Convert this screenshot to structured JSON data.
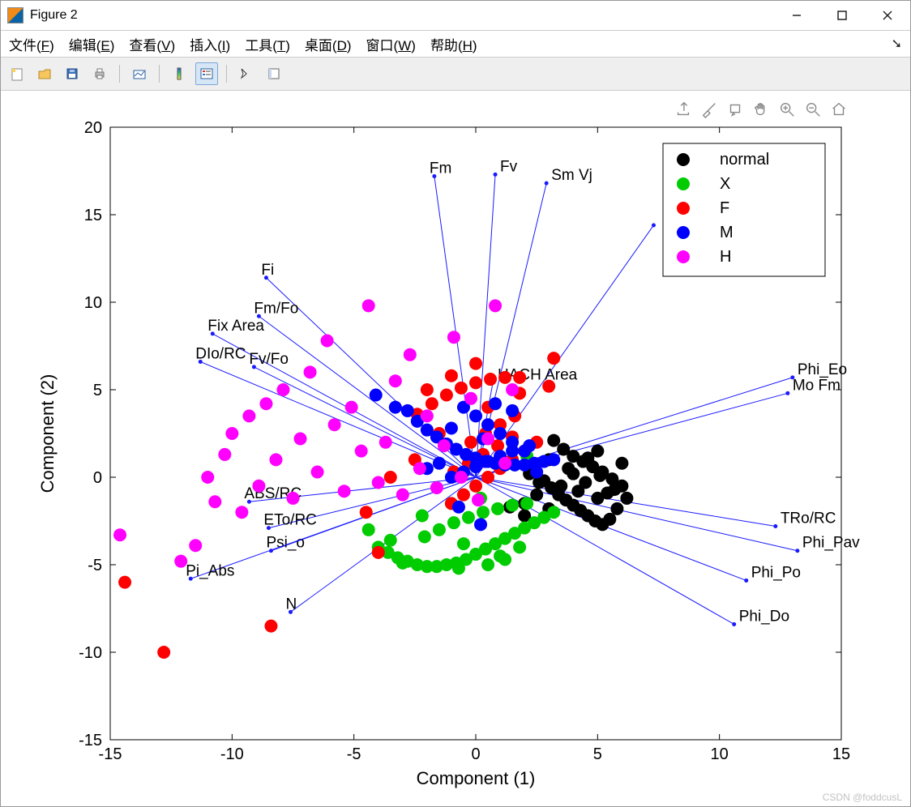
{
  "window": {
    "title": "Figure 2"
  },
  "menu": {
    "file": {
      "label": "文件",
      "mn": "F"
    },
    "edit": {
      "label": "编辑",
      "mn": "E"
    },
    "view": {
      "label": "查看",
      "mn": "V"
    },
    "insert": {
      "label": "插入",
      "mn": "I"
    },
    "tools": {
      "label": "工具",
      "mn": "T"
    },
    "desktop": {
      "label": "桌面",
      "mn": "D"
    },
    "window": {
      "label": "窗口",
      "mn": "W"
    },
    "help": {
      "label": "帮助",
      "mn": "H"
    }
  },
  "axes_toolbar": {
    "export": "export-icon",
    "brush": "brush-icon",
    "datatip": "data-tip-icon",
    "pan": "pan-icon",
    "zoomin": "zoom-in-icon",
    "zoomout": "zoom-out-icon",
    "home": "home-icon"
  },
  "legend": {
    "entries": [
      {
        "label": "normal",
        "color": "#000000"
      },
      {
        "label": "X",
        "color": "#00cc00"
      },
      {
        "label": "F",
        "color": "#ff0000"
      },
      {
        "label": "M",
        "color": "#0000ff"
      },
      {
        "label": "H",
        "color": "#ff00ff"
      }
    ]
  },
  "chart_data": {
    "type": "scatter",
    "title": "",
    "xlabel": "Component (1)",
    "ylabel": "Component (2)",
    "xlim": [
      -15,
      15
    ],
    "ylim": [
      -15,
      20
    ],
    "xticks": [
      -15,
      -10,
      -5,
      0,
      5,
      10,
      15
    ],
    "yticks": [
      -15,
      -10,
      -5,
      0,
      5,
      10,
      15,
      20
    ],
    "grid": false,
    "legend_position": "top-right",
    "biplot_vectors": [
      {
        "name": "Fm",
        "x": -1.7,
        "y": 17.2
      },
      {
        "name": "Fv",
        "x": 0.8,
        "y": 17.3
      },
      {
        "name": "Sm Vj",
        "x": 2.9,
        "y": 16.8
      },
      {
        "name": "",
        "x": 7.3,
        "y": 14.4
      },
      {
        "name": "Fi",
        "x": -8.6,
        "y": 11.4
      },
      {
        "name": "Fm/Fo",
        "x": -8.9,
        "y": 9.2
      },
      {
        "name": "Fix Area",
        "x": -10.8,
        "y": 8.2
      },
      {
        "name": "DIo/RC",
        "x": -11.3,
        "y": 6.6
      },
      {
        "name": "Fv/Fo",
        "x": -9.1,
        "y": 6.3
      },
      {
        "name": "HACH Area",
        "x": 0.7,
        "y": 5.4
      },
      {
        "name": "Phi_Eo",
        "x": 13.0,
        "y": 5.7
      },
      {
        "name": "Mo Fm",
        "x": 12.8,
        "y": 4.8
      },
      {
        "name": "ABS/RC",
        "x": -9.3,
        "y": -1.4
      },
      {
        "name": "ETo/RC",
        "x": -8.5,
        "y": -2.9
      },
      {
        "name": "Psi_o",
        "x": -8.4,
        "y": -4.2
      },
      {
        "name": "Pi_Abs",
        "x": -11.7,
        "y": -5.8
      },
      {
        "name": "N",
        "x": -7.6,
        "y": -7.7
      },
      {
        "name": "TRo/RC",
        "x": 12.3,
        "y": -2.8
      },
      {
        "name": "Phi_Pav",
        "x": 13.2,
        "y": -4.2
      },
      {
        "name": "Phi_Po",
        "x": 11.1,
        "y": -5.9
      },
      {
        "name": "Phi_Do",
        "x": 10.6,
        "y": -8.4
      }
    ],
    "series": [
      {
        "name": "normal",
        "color": "#000000",
        "points": [
          [
            3.2,
            2.1
          ],
          [
            3.6,
            1.6
          ],
          [
            4.0,
            1.2
          ],
          [
            4.4,
            0.9
          ],
          [
            4.8,
            0.6
          ],
          [
            5.2,
            0.3
          ],
          [
            5.6,
            -0.1
          ],
          [
            6.0,
            -0.5
          ],
          [
            2.8,
            -0.2
          ],
          [
            3.1,
            -0.6
          ],
          [
            3.4,
            -1.0
          ],
          [
            3.7,
            -1.3
          ],
          [
            4.0,
            -1.6
          ],
          [
            4.3,
            -1.9
          ],
          [
            4.6,
            -2.2
          ],
          [
            4.9,
            -2.5
          ],
          [
            5.2,
            -2.7
          ],
          [
            5.5,
            -2.4
          ],
          [
            5.8,
            -1.8
          ],
          [
            6.2,
            -1.2
          ],
          [
            6.0,
            0.8
          ],
          [
            5.0,
            1.5
          ],
          [
            4.5,
            -0.3
          ],
          [
            3.0,
            1.0
          ],
          [
            2.0,
            -1.5
          ],
          [
            2.5,
            -1.0
          ],
          [
            3.0,
            -1.8
          ],
          [
            3.5,
            -0.5
          ],
          [
            4.0,
            0.2
          ],
          [
            4.2,
            -0.8
          ],
          [
            5.0,
            -1.2
          ],
          [
            5.4,
            -0.9
          ],
          [
            2.2,
            0.2
          ],
          [
            2.6,
            -0.3
          ],
          [
            3.8,
            0.5
          ],
          [
            4.6,
            1.1
          ],
          [
            5.1,
            0.1
          ],
          [
            5.7,
            -0.7
          ],
          [
            1.4,
            -1.7
          ],
          [
            2.0,
            -2.2
          ]
        ]
      },
      {
        "name": "X",
        "color": "#00cc00",
        "points": [
          [
            -4.4,
            -3.0
          ],
          [
            -4.0,
            -4.0
          ],
          [
            -3.6,
            -4.3
          ],
          [
            -3.2,
            -4.6
          ],
          [
            -2.8,
            -4.8
          ],
          [
            -2.4,
            -5.0
          ],
          [
            -2.0,
            -5.1
          ],
          [
            -1.6,
            -5.1
          ],
          [
            -1.2,
            -5.0
          ],
          [
            -0.8,
            -4.9
          ],
          [
            -0.4,
            -4.7
          ],
          [
            0.0,
            -4.4
          ],
          [
            0.4,
            -4.1
          ],
          [
            0.8,
            -3.8
          ],
          [
            1.2,
            -3.5
          ],
          [
            1.6,
            -3.2
          ],
          [
            2.0,
            -2.9
          ],
          [
            2.4,
            -2.6
          ],
          [
            2.8,
            -2.3
          ],
          [
            3.2,
            -2.0
          ],
          [
            -2.1,
            -3.4
          ],
          [
            -1.5,
            -3.0
          ],
          [
            -0.9,
            -2.6
          ],
          [
            -0.3,
            -2.3
          ],
          [
            0.3,
            -2.0
          ],
          [
            0.9,
            -1.8
          ],
          [
            1.5,
            -1.6
          ],
          [
            2.1,
            -1.5
          ],
          [
            -3.0,
            -4.9
          ],
          [
            -2.2,
            -2.2
          ],
          [
            -1.0,
            -1.5
          ],
          [
            0.2,
            -1.2
          ],
          [
            1.0,
            -4.5
          ],
          [
            1.8,
            -4.0
          ],
          [
            2.1,
            1.2
          ],
          [
            -0.7,
            -5.2
          ],
          [
            0.5,
            -5.0
          ],
          [
            1.2,
            -4.7
          ],
          [
            -3.5,
            -3.6
          ],
          [
            -0.5,
            -3.8
          ]
        ]
      },
      {
        "name": "F",
        "color": "#ff0000",
        "points": [
          [
            -14.4,
            -6.0
          ],
          [
            -12.8,
            -10.0
          ],
          [
            -8.4,
            -8.5
          ],
          [
            -4.0,
            -4.3
          ],
          [
            -2.4,
            3.6
          ],
          [
            -1.8,
            4.2
          ],
          [
            -1.2,
            4.7
          ],
          [
            -0.6,
            5.1
          ],
          [
            0.0,
            5.4
          ],
          [
            0.6,
            5.6
          ],
          [
            1.2,
            5.7
          ],
          [
            1.8,
            5.7
          ],
          [
            -1.0,
            -1.5
          ],
          [
            -0.5,
            -1.0
          ],
          [
            0.0,
            -0.5
          ],
          [
            0.5,
            0.0
          ],
          [
            1.0,
            0.5
          ],
          [
            1.5,
            1.0
          ],
          [
            2.0,
            1.5
          ],
          [
            2.5,
            2.0
          ],
          [
            0.0,
            6.5
          ],
          [
            3.2,
            6.8
          ],
          [
            3.0,
            5.2
          ],
          [
            -0.9,
            0.3
          ],
          [
            -0.3,
            0.8
          ],
          [
            0.3,
            1.3
          ],
          [
            0.9,
            1.8
          ],
          [
            1.5,
            2.3
          ],
          [
            -1.5,
            2.5
          ],
          [
            -2.5,
            1.0
          ],
          [
            -3.5,
            0.0
          ],
          [
            -4.5,
            -2.0
          ],
          [
            -0.2,
            2.0
          ],
          [
            0.4,
            2.5
          ],
          [
            1.0,
            3.0
          ],
          [
            1.6,
            3.5
          ],
          [
            -2.0,
            5.0
          ],
          [
            -1.0,
            5.8
          ],
          [
            0.5,
            4.0
          ],
          [
            1.8,
            4.8
          ]
        ]
      },
      {
        "name": "M",
        "color": "#0000ff",
        "points": [
          [
            -2.8,
            3.8
          ],
          [
            -2.4,
            3.2
          ],
          [
            -2.0,
            2.7
          ],
          [
            -1.6,
            2.3
          ],
          [
            -1.2,
            1.9
          ],
          [
            -0.8,
            1.6
          ],
          [
            -0.4,
            1.3
          ],
          [
            0.0,
            1.1
          ],
          [
            0.4,
            0.9
          ],
          [
            0.8,
            0.8
          ],
          [
            1.2,
            0.7
          ],
          [
            1.6,
            0.7
          ],
          [
            2.0,
            0.7
          ],
          [
            2.4,
            0.8
          ],
          [
            2.8,
            0.9
          ],
          [
            3.2,
            1.0
          ],
          [
            -0.5,
            4.0
          ],
          [
            0.0,
            3.5
          ],
          [
            0.5,
            3.0
          ],
          [
            1.0,
            2.5
          ],
          [
            1.5,
            2.0
          ],
          [
            2.0,
            1.5
          ],
          [
            -4.1,
            4.7
          ],
          [
            -3.3,
            4.0
          ],
          [
            -1.0,
            0.0
          ],
          [
            -0.5,
            0.3
          ],
          [
            0.0,
            0.6
          ],
          [
            0.5,
            0.9
          ],
          [
            1.0,
            1.2
          ],
          [
            1.5,
            1.5
          ],
          [
            -0.7,
            -1.7
          ],
          [
            0.2,
            -2.7
          ],
          [
            -2.0,
            0.5
          ],
          [
            -1.5,
            0.8
          ],
          [
            0.8,
            4.2
          ],
          [
            1.5,
            3.8
          ],
          [
            2.2,
            1.8
          ],
          [
            -1.0,
            2.8
          ],
          [
            0.3,
            2.2
          ],
          [
            2.5,
            0.3
          ]
        ]
      },
      {
        "name": "H",
        "color": "#ff00ff",
        "points": [
          [
            -14.6,
            -3.3
          ],
          [
            -11.5,
            -3.9
          ],
          [
            -11.0,
            0.0
          ],
          [
            -10.7,
            -1.4
          ],
          [
            -10.3,
            1.3
          ],
          [
            -10.0,
            2.5
          ],
          [
            -9.6,
            -2.0
          ],
          [
            -9.3,
            3.5
          ],
          [
            -8.9,
            -0.5
          ],
          [
            -8.6,
            4.2
          ],
          [
            -8.2,
            1.0
          ],
          [
            -7.9,
            5.0
          ],
          [
            -7.5,
            -1.2
          ],
          [
            -7.2,
            2.2
          ],
          [
            -6.8,
            6.0
          ],
          [
            -6.5,
            0.3
          ],
          [
            -6.1,
            7.8
          ],
          [
            -5.8,
            3.0
          ],
          [
            -5.4,
            -0.8
          ],
          [
            -5.1,
            4.0
          ],
          [
            -4.7,
            1.5
          ],
          [
            -4.4,
            9.8
          ],
          [
            -4.0,
            -0.3
          ],
          [
            -3.7,
            2.0
          ],
          [
            -3.3,
            5.5
          ],
          [
            -3.0,
            -1.0
          ],
          [
            -2.7,
            7.0
          ],
          [
            -2.3,
            0.5
          ],
          [
            -2.0,
            3.5
          ],
          [
            -1.6,
            -0.6
          ],
          [
            -1.3,
            1.8
          ],
          [
            -0.9,
            8.0
          ],
          [
            -0.6,
            0.0
          ],
          [
            -0.2,
            4.5
          ],
          [
            0.1,
            -1.3
          ],
          [
            0.5,
            2.2
          ],
          [
            0.8,
            9.8
          ],
          [
            1.2,
            0.8
          ],
          [
            1.5,
            5.0
          ],
          [
            -12.1,
            -4.8
          ]
        ]
      }
    ]
  },
  "watermark": "CSDN @foddcusL"
}
